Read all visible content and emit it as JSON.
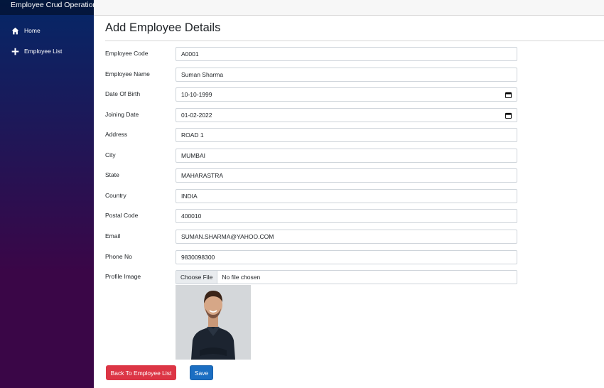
{
  "sidebar": {
    "brand": "Employee Crud Operations",
    "items": [
      {
        "label": "Home",
        "icon": "home-icon"
      },
      {
        "label": "Employee List",
        "icon": "plus-icon"
      }
    ]
  },
  "page": {
    "title": "Add Employee Details"
  },
  "form": {
    "employee_code": {
      "label": "Employee Code",
      "value": "A0001"
    },
    "employee_name": {
      "label": "Employee Name",
      "value": "Suman Sharma"
    },
    "date_of_birth": {
      "label": "Date Of Birth",
      "value": "10-10-1999"
    },
    "joining_date": {
      "label": "Joining Date",
      "value": "01-02-2022"
    },
    "address": {
      "label": "Address",
      "value": "ROAD 1"
    },
    "city": {
      "label": "City",
      "value": "MUMBAI"
    },
    "state": {
      "label": "State",
      "value": "MAHARASTRA"
    },
    "country": {
      "label": "Country",
      "value": "INDIA"
    },
    "postal_code": {
      "label": "Postal Code",
      "value": "400010"
    },
    "email": {
      "label": "Email",
      "value": "SUMAN.SHARMA@YAHOO.COM"
    },
    "phone_no": {
      "label": "Phone No",
      "value": "9830098300"
    },
    "profile_image": {
      "label": "Profile Image",
      "button": "Choose File",
      "status": "No file chosen"
    }
  },
  "actions": {
    "back_label": "Back To Employee List",
    "save_label": "Save"
  },
  "colors": {
    "sidebar_top": "#052767",
    "sidebar_bottom": "#3a0647",
    "danger": "#dc3545",
    "primary": "#1b6ec2"
  }
}
